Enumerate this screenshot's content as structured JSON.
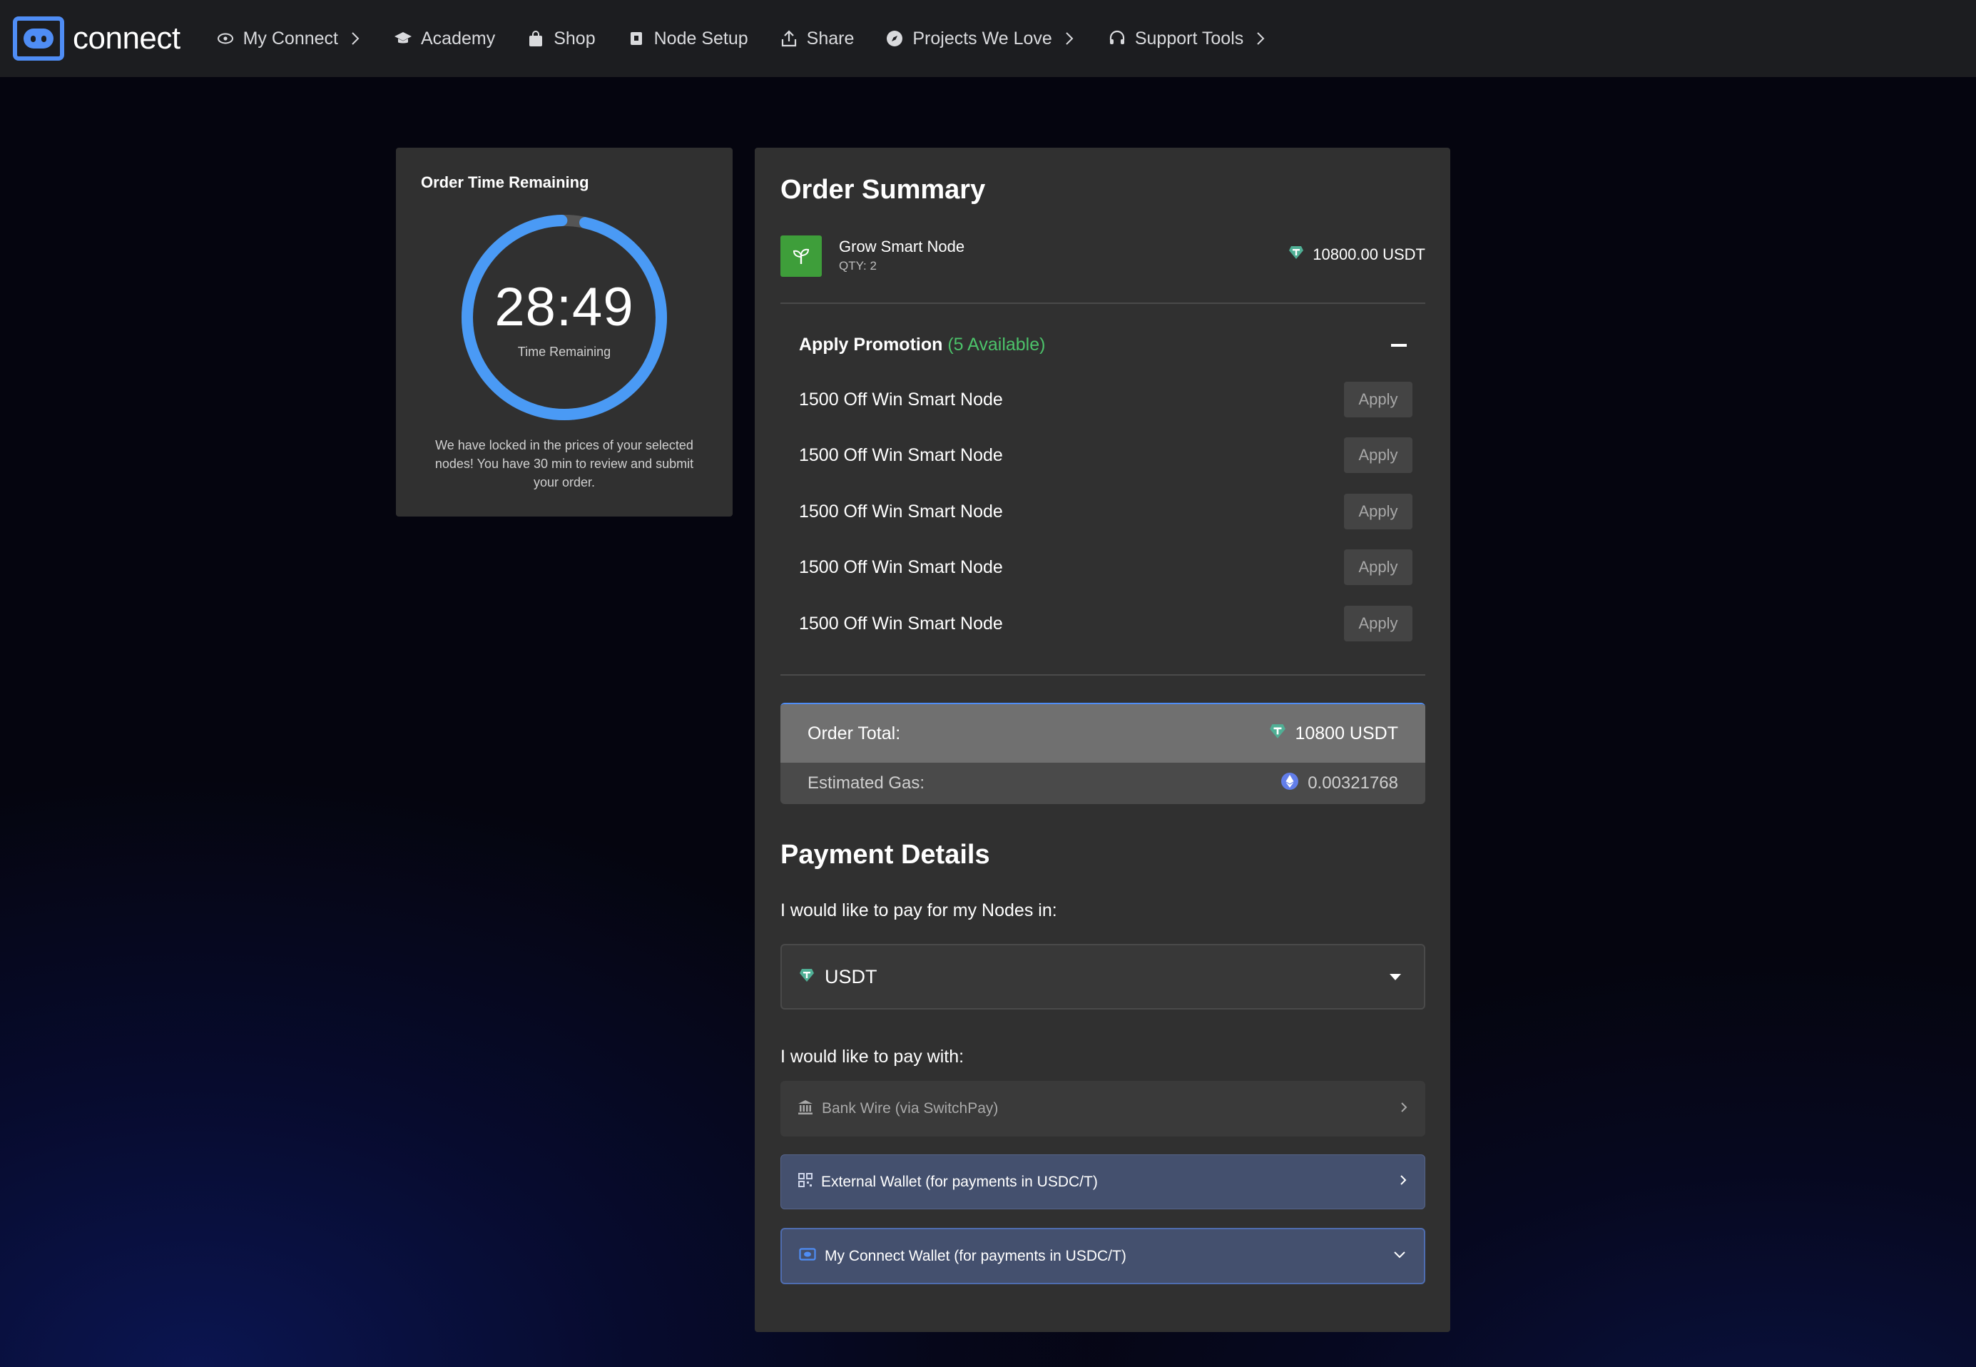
{
  "brand": {
    "logo_text": "connect",
    "accent": "#4f8df5"
  },
  "nav": {
    "items": [
      {
        "label": "My Connect",
        "icon": "eye-icon",
        "has_chevron": true
      },
      {
        "label": "Academy",
        "icon": "graduation-cap-icon",
        "has_chevron": false
      },
      {
        "label": "Shop",
        "icon": "shopping-bag-icon",
        "has_chevron": false
      },
      {
        "label": "Node Setup",
        "icon": "node-box-icon",
        "has_chevron": false
      },
      {
        "label": "Share",
        "icon": "share-icon",
        "has_chevron": false
      },
      {
        "label": "Projects We Love",
        "icon": "compass-icon",
        "has_chevron": true
      },
      {
        "label": "Support Tools",
        "icon": "headset-icon",
        "has_chevron": true
      }
    ]
  },
  "timer": {
    "title": "Order Time Remaining",
    "value": "28:49",
    "subtitle": "Time Remaining",
    "note": "We have locked in the prices of your selected nodes! You have 30 min to review and submit your order.",
    "remaining_fraction": 0.961,
    "ring_color": "#4a9af5",
    "track_color": "#555555"
  },
  "order": {
    "title": "Order Summary",
    "product": {
      "name": "Grow Smart Node",
      "qty": "QTY: 2",
      "price": "10800.00 USDT",
      "icon": "sprout-icon",
      "icon_bg": "#3e9e3a"
    },
    "promotion": {
      "label": "Apply Promotion",
      "available": "(5 Available)",
      "available_color": "#4cc26a",
      "items": [
        {
          "label": "1500 Off Win Smart Node",
          "button": "Apply"
        },
        {
          "label": "1500 Off Win Smart Node",
          "button": "Apply"
        },
        {
          "label": "1500 Off Win Smart Node",
          "button": "Apply"
        },
        {
          "label": "1500 Off Win Smart Node",
          "button": "Apply"
        },
        {
          "label": "1500 Off Win Smart Node",
          "button": "Apply"
        }
      ]
    },
    "total_label": "Order Total:",
    "total_value": "10800 USDT",
    "gas_label": "Estimated Gas:",
    "gas_value": "0.00321768"
  },
  "payment": {
    "title": "Payment Details",
    "currency_label": "I would like to pay for my Nodes in:",
    "currency_value": "USDT",
    "method_label": "I would like to pay with:",
    "methods": [
      {
        "label": "Bank Wire (via SwitchPay)",
        "icon": "bank-icon",
        "chevron": "chevron-right-icon"
      },
      {
        "label": "External Wallet (for payments in USDC/T)",
        "icon": "qr-code-icon",
        "chevron": "chevron-right-icon"
      },
      {
        "label": "My Connect Wallet (for payments in USDC/T)",
        "icon": "wallet-icon",
        "chevron": "chevron-down-icon"
      }
    ]
  }
}
